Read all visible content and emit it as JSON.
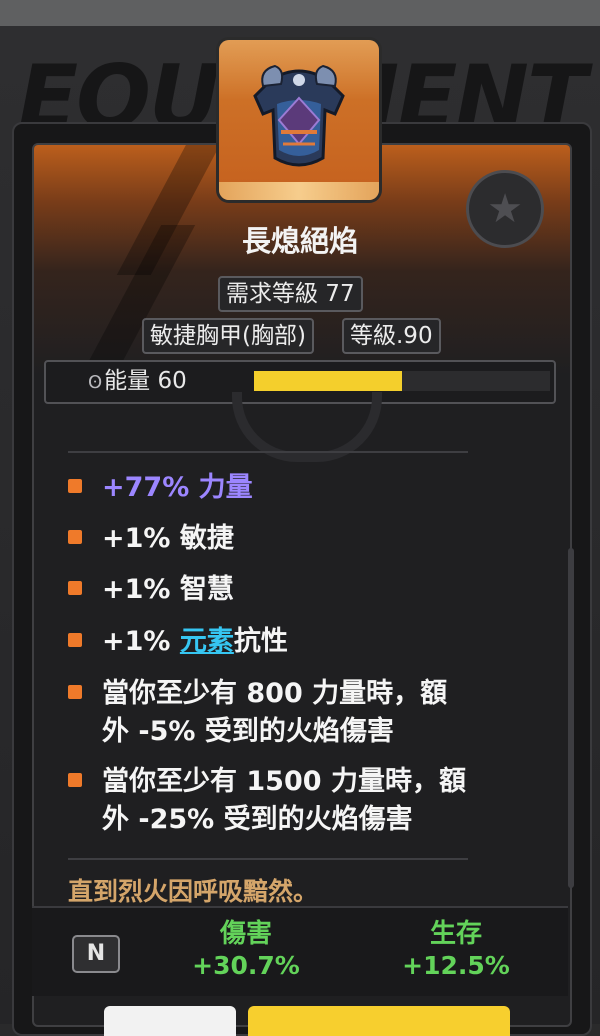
{
  "background": {
    "title_text": "EQUIPMENT"
  },
  "item": {
    "name": "長熄絕焰",
    "icon": "chest-armor-icon",
    "badge_icon": "star-icon",
    "required_level": "需求等級 77",
    "type": "敏捷胸甲(胸部)",
    "item_level": "等級.90"
  },
  "energy": {
    "icon": "energy-swirl-icon",
    "label": "能量 60",
    "fill_fraction": 0.5
  },
  "stats": [
    {
      "text": "+77% 力量",
      "style": "purple"
    },
    {
      "text": "+1% 敏捷"
    },
    {
      "text": "+1% 智慧"
    },
    {
      "prefix": "+1% ",
      "keyword": "元素",
      "suffix": "抗性"
    },
    {
      "line1": "當你至少有 800 力量時，額",
      "line2": "外 -5% 受到的火焰傷害"
    },
    {
      "line1": "當你至少有 1500 力量時，額",
      "line2": "外 -25% 受到的火焰傷害"
    }
  ],
  "lore": "直到烈火因呼吸黯然。",
  "footer": {
    "key_hint": "N",
    "damage_label": "傷害",
    "damage_value": "+30.7%",
    "survival_label": "生存",
    "survival_value": "+12.5%"
  },
  "colors": {
    "accent_orange": "#ef7a2a",
    "energy_yellow": "#f4cf2c",
    "strength_purple": "#9c86ff",
    "keyword_cyan": "#36c6f2",
    "compare_green": "#63d35a",
    "lore_tan": "#d4a56a"
  }
}
